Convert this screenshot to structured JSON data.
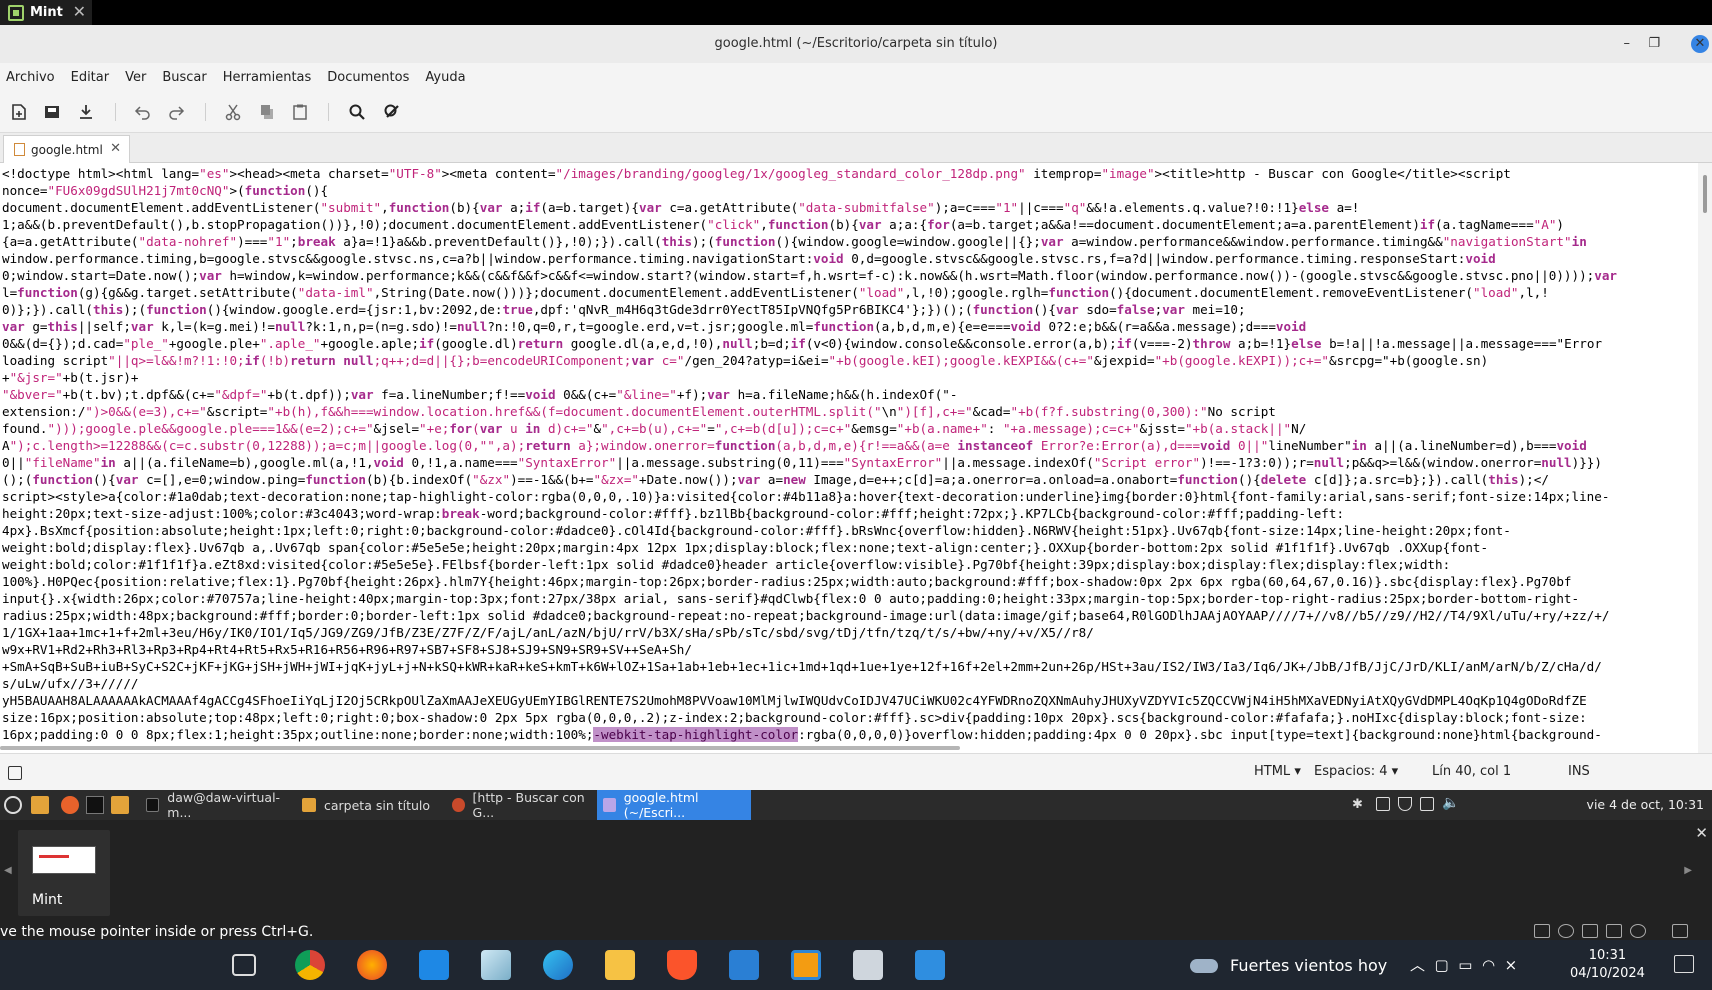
{
  "vm_tab": {
    "label": "Mint"
  },
  "window": {
    "title": "google.html (~/Escritorio/carpeta sin título)",
    "minimize": "–",
    "maximize": "❐",
    "close": "✕"
  },
  "menu": [
    "Archivo",
    "Editar",
    "Ver",
    "Buscar",
    "Herramientas",
    "Documentos",
    "Ayuda"
  ],
  "toolbar_icons": [
    "new-document-icon",
    "open-icon",
    "save-download-icon",
    "undo-icon",
    "redo-icon",
    "cut-icon",
    "copy-icon",
    "paste-icon",
    "search-icon",
    "find-replace-icon"
  ],
  "doc_tab": {
    "label": "google.html",
    "close": "✕"
  },
  "code_lines": [
    "<!doctype html><html lang=\"es\"><head><meta charset=\"UTF-8\"><meta content=\"/images/branding/googleg/1x/googleg_standard_color_128dp.png\" itemprop=\"image\"><title>http - Buscar con Google</title><script",
    "nonce=\"FU6x09gdSUlH21j7mt0cNQ\">(function(){",
    "document.documentElement.addEventListener(\"submit\",function(b){var a;if(a=b.target){var c=a.getAttribute(\"data-submitfalse\");a=c===\"1\"||c===\"q\"&&!a.elements.q.value?!0:!1}else a=!",
    "1;a&&(b.preventDefault(),b.stopPropagation())},!0);document.documentElement.addEventListener(\"click\",function(b){var a;a:{for(a=b.target;a&&a!==document.documentElement;a=a.parentElement)if(a.tagName===\"A\")",
    "{a=a.getAttribute(\"data-nohref\")===\"1\";break a}a=!1}a&&b.preventDefault()},!0);}).call(this);(function(){window.google=window.google||{};var a=window.performance&&window.performance.timing&&\"navigationStart\"in",
    "window.performance.timing,b=google.stvsc&&google.stvsc.ns,c=a?b||window.performance.timing.navigationStart:void 0,d=google.stvsc&&google.stvsc.rs,f=a?d||window.performance.timing.responseStart:void",
    "0;window.start=Date.now();var h=window,k=window.performance;k&&(c&&f&&f>c&&f<=window.start?(window.start=f,h.wsrt=f-c):k.now&&(h.wsrt=Math.floor(window.performance.now())-(google.stvsc&&google.stvsc.pno||0))));var",
    "l=function(g){g&&g.target.setAttribute(\"data-iml\",String(Date.now()))};document.documentElement.addEventListener(\"load\",l,!0);google.rglh=function(){document.documentElement.removeEventListener(\"load\",l,!",
    "0)};}).call(this);(function(){window.google.erd={jsr:1,bv:2092,de:true,dpf:'qNvR_m4H6q3tGde3drr0YectT85IpVNQfg5Pr6BIKC4'};})();(function(){var sdo=false;var mei=10;",
    "var g=this||self;var k,l=(k=g.mei)!=null?k:1,n,p=(n=g.sdo)!=null?n:!0,q=0,r,t=google.erd,v=t.jsr;google.ml=function(a,b,d,m,e){e=e===void 0?2:e;b&&(r=a&&a.message);d===void",
    "0&&(d={});d.cad=\"ple_\"+google.ple+\".aple_\"+google.aple;if(google.dl)return google.dl(a,e,d,!0),null;b=d;if(v<0){window.console&&console.error(a,b);if(v===-2)throw a;b=!1}else b=!a||!a.message||a.message===\"Error",
    "loading script\"||q>=l&&!m?!1:!0;if(!b)return null;q++;d=d||{};b=encodeURIComponent;var c=\"/gen_204?atyp=i&ei=\"+b(google.kEI);google.kEXPI&&(c+=\"&jexpid=\"+b(google.kEXPI));c+=\"&srcpg=\"+b(google.sn)",
    "+\"&jsr=\"+b(t.jsr)+",
    "\"&bver=\"+b(t.bv);t.dpf&&(c+=\"&dpf=\"+b(t.dpf));var f=a.lineNumber;f!==void 0&&(c+=\"&line=\"+f);var h=a.fileName;h&&(h.indexOf(\"-",
    "extension:/\")>0&&(e=3),c+=\"&script=\"+b(h),f&&h===window.location.href&&(f=document.documentElement.outerHTML.split(\"\\n\")[f],c+=\"&cad=\"+b(f?f.substring(0,300):\"No script",
    "found.\")));google.ple&&google.ple===1&&(e=2);c+=\"&jsel=\"+e;for(var u in d)c+=\"&\",c+=b(u),c+=\"=\",c+=b(d[u]);c=c+\"&emsg=\"+b(a.name+\": \"+a.message);c=c+\"&jsst=\"+b(a.stack||\"N/",
    "A\");c.length>=12288&&(c=c.substr(0,12288));a=c;m||google.log(0,\"\",a);return a};window.onerror=function(a,b,d,m,e){r!==a&&(a=e instanceof Error?e:Error(a),d===void 0||\"lineNumber\"in a||(a.lineNumber=d),b===void",
    "0||\"fileName\"in a||(a.fileName=b),google.ml(a,!1,void 0,!1,a.name===\"SyntaxError\"||a.message.substring(0,11)===\"SyntaxError\"||a.message.indexOf(\"Script error\")!==-1?3:0));r=null;p&&q>=l&&(window.onerror=null)}})",
    "();(function(){var c=[],e=0;window.ping=function(b){b.indexOf(\"&zx\")==-1&&(b+=\"&zx=\"+Date.now());var a=new Image,d=e++;c[d]=a;a.onerror=a.onload=a.onabort=function(){delete c[d]};a.src=b};}).call(this);</",
    "script><style>a{color:#1a0dab;text-decoration:none;tap-highlight-color:rgba(0,0,0,.10)}a:visited{color:#4b11a8}a:hover{text-decoration:underline}img{border:0}html{font-family:arial,sans-serif;font-size:14px;line-",
    "height:20px;text-size-adjust:100%;color:#3c4043;word-wrap:break-word;background-color:#fff}.bz1lBb{background-color:#fff;height:72px;}.KP7LCb{background-color:#fff;padding-left:",
    "4px}.BsXmcf{position:absolute;height:1px;left:0;right:0;background-color:#dadce0}.cOl4Id{background-color:#fff}.bRsWnc{overflow:hidden}.N6RWV{height:51px}.Uv67qb{font-size:14px;line-height:20px;font-",
    "weight:bold;display:flex}.Uv67qb a,.Uv67qb span{color:#5e5e5e;height:20px;margin:4px 12px 1px;display:block;flex:none;text-align:center;}.OXXup{border-bottom:2px solid #1f1f1f}.Uv67qb .OXXup{font-",
    "weight:bold;color:#1f1f1f}a.eZt8xd:visited{color:#5e5e5e}.FElbsf{border-left:1px solid #dadce0}header article{overflow:visible}.Pg70bf{height:39px;display:box;display:flex;display:flex;width:",
    "100%}.H0PQec{position:relative;flex:1}.Pg70bf{height:26px}.hlm7Y{height:46px;margin-top:26px;border-radius:25px;width:auto;background:#fff;box-shadow:0px 2px 6px rgba(60,64,67,0.16)}.sbc{display:flex}.Pg70bf",
    "input{}.x{width:26px;color:#70757a;line-height:40px;margin-top:3px;font:27px/38px arial, sans-serif}#qdClwb{flex:0 0 auto;padding:0;height:33px;margin-top:5px;border-top-right-radius:25px;border-bottom-right-",
    "radius:25px;width:48px;background:#fff;border:0;border-left:1px solid #dadce0;background-repeat:no-repeat;background-image:url(data:image/gif;base64,R0lGODlhJAAjAOYAAP////7+//v8//b5//z9//H2//T4/9Xl/uTu/+ry/+zz/+/",
    "1/1GX+1aa+1mc+1+f+2ml+3eu/H6y/IK0/IO1/Iq5/JG9/ZG9/JfB/Z3E/Z7F/Z/F/ajL/anL/azN/bjU/rrV/b3X/sHa/sPb/sTc/sbd/svg/tDj/tfn/tzq/t/s/+bw/+ny/+v/X5//r8/",
    "w9x+RV1+Rd2+Rh3+Rl3+Rp3+Rp4+Rt4+Rt5+Rx5+R16+R56+R96+R97+SB7+SF8+SJ8+SJ9+SN9+SR9+SV++SeA+Sh/",
    "+SmA+SqB+SuB+iuB+SyC+S2C+jKF+jKG+jSH+jWH+jWI+jqK+jyL+j+N+kSQ+kWR+kaR+keS+kmT+k6W+lOZ+1Sa+1ab+1eb+1ec+1ic+1md+1qd+1ue+1ye+12f+16f+2el+2mm+2un+26p/HSt+3au/IS2/IW3/Ia3/Iq6/JK+/JbB/JfB/JjC/JrD/KLI/anM/arN/b/Z/cHa/d/",
    "s/uLw/ufx//3+/////",
    "yH5BAUAAH8ALAAAAAAkACMAAAf4gACCg4SFhoeIiYqLjI2Oj5CRkpOUlZaXmAAJeXEUGyUEmYIBGlRENTE7S2UmohM8PVVoaw10MlMjlwIWQUdvCoIDJV47UCiWKU02c4YFWDRnoZQXNmAuhyJHUXyVZDYVIc5ZQCCVWjN4iH5hMXaVEDNyiAtXQyGVdDMPL4OqKp1Q4gODoRdfZE",
    "size:16px;position:absolute;top:48px;left:0;right:0;box-shadow:0 2px 5px rgba(0,0,0,.2);z-index:2;background-color:#fff}.sc>div{padding:10px 20px}.scs{background-color:#fafafa;}.noHIxc{display:block;font-size:",
    "16px;padding:0 0 0 8px;flex:1;height:35px;outline:none;border:none;width:100%;-webkit-tap-highlight-color:rgba(0,0,0,0)}overflow:hidden;padding:4px 0 0 20px}.sbc input[type=text]{background:none}html{background-"
  ],
  "status": {
    "language": "HTML",
    "spaces": "Espacios: 4",
    "position": "Lín 40, col 1",
    "mode": "INS"
  },
  "mint_panel": {
    "windows": [
      "daw@daw-virtual-m...",
      "carpeta sin título",
      "[http - Buscar con G...",
      "google.html (~/Escri..."
    ],
    "clock": "vie 4 de oct, 10:31"
  },
  "thumbnail": {
    "label": "Mint"
  },
  "vm_hint": "ve the mouse pointer inside or press Ctrl+G.",
  "weather": "Fuertes vientos hoy",
  "taskbar_time": "10:31",
  "taskbar_date": "04/10/2024"
}
